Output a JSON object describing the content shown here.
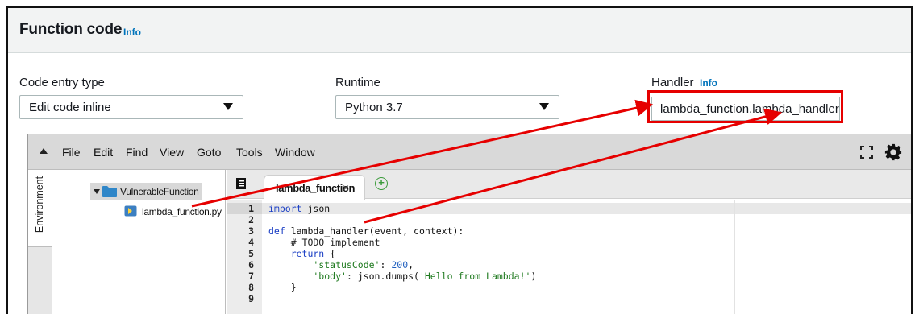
{
  "header": {
    "title": "Function code",
    "info": "Info"
  },
  "code_entry": {
    "label": "Code entry type",
    "value": "Edit code inline",
    "icon": "chevron-down-icon"
  },
  "runtime": {
    "label": "Runtime",
    "value": "Python 3.7",
    "icon": "chevron-down-icon"
  },
  "handler": {
    "label": "Handler",
    "info": "Info",
    "value": "lambda_function.lambda_handler"
  },
  "ide": {
    "menu": [
      "File",
      "Edit",
      "Find",
      "View",
      "Goto",
      "Tools",
      "Window"
    ],
    "sidebar_tab": "Environment",
    "tree": {
      "root": "VulnerableFunction",
      "file": "lambda_function.py"
    },
    "tab": {
      "label": "lambda_function",
      "close": "×"
    },
    "new_tab": "+",
    "line_numbers": [
      "1",
      "2",
      "3",
      "4",
      "5",
      "6",
      "7",
      "8",
      "9"
    ]
  },
  "code_lines": {
    "l1_kw": "import",
    "l1_rest": " json",
    "l3_kw": "def",
    "l3_rest": " lambda_handler(event, context):",
    "l4": "    # TODO implement",
    "l5_kw": "    return",
    "l5_rest": " {",
    "l6_str": "        'statusCode'",
    "l6_mid": ": ",
    "l6_num": "200",
    "l6_end": ",",
    "l7_str": "        'body'",
    "l7_mid": ": json.dumps(",
    "l7_str2": "'Hello from Lambda!'",
    "l7_end": ")",
    "l8": "    }"
  },
  "colors": {
    "annotation": "#e60000",
    "link": "#0073bb",
    "menu_bar": "#d9d9d9"
  }
}
